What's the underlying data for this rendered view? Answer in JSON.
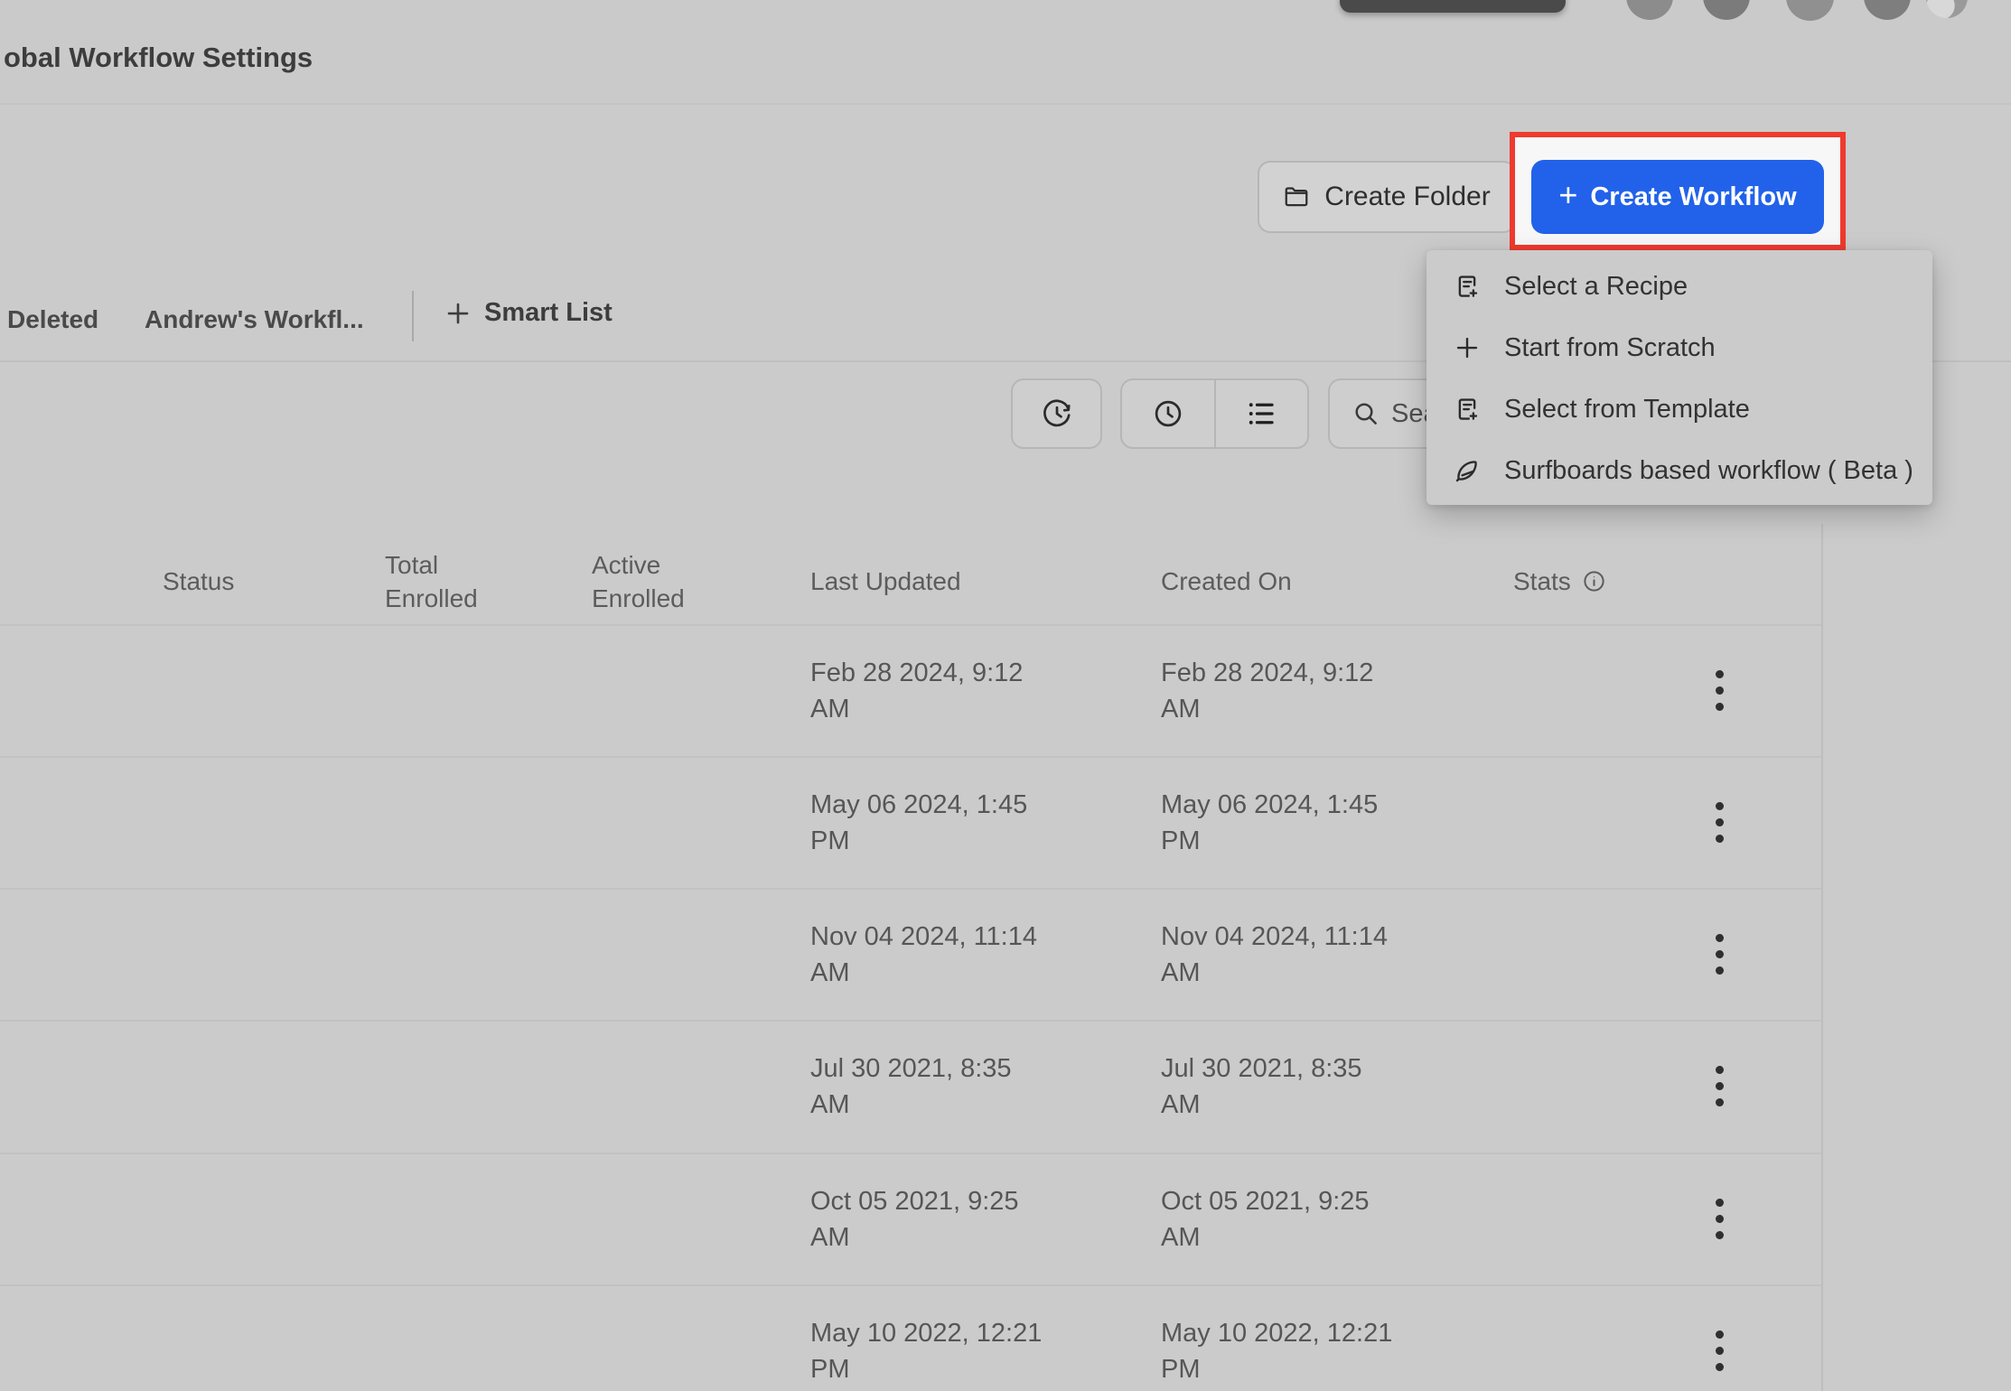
{
  "header": {
    "title": "obal Workflow Settings",
    "avatars": [
      "avatar-1",
      "avatar-2",
      "avatar-3",
      "avatar-4",
      "avatar-photo"
    ]
  },
  "toolbar": {
    "create_folder": "Create Folder",
    "create_workflow": "Create Workflow",
    "create_workflow_plus": "+"
  },
  "create_menu": {
    "items": [
      {
        "label": "Select a Recipe",
        "icon": "doc-plus-icon"
      },
      {
        "label": "Start from Scratch",
        "icon": "plus-icon"
      },
      {
        "label": "Select from Template",
        "icon": "doc-plus-icon"
      },
      {
        "label": "Surfboards based workflow ( Beta )",
        "icon": "surfboard-icon"
      }
    ]
  },
  "tabs": {
    "deleted": "Deleted",
    "andrews": "Andrew's Workfl...",
    "smart_list": "Smart List"
  },
  "search": {
    "visible_text": "Sea"
  },
  "table": {
    "columns": {
      "status": "Status",
      "total_enrolled": "Total Enrolled",
      "active_enrolled": "Active Enrolled",
      "last_updated": "Last Updated",
      "created_on": "Created On",
      "stats": "Stats"
    },
    "rows": [
      {
        "last_updated": [
          "Feb 28 2024, 9:12",
          "AM"
        ],
        "created_on": [
          "Feb 28 2024, 9:12",
          "AM"
        ]
      },
      {
        "last_updated": [
          "May 06 2024, 1:45",
          "PM"
        ],
        "created_on": [
          "May 06 2024, 1:45",
          "PM"
        ]
      },
      {
        "last_updated": [
          "Nov 04 2024, 11:14",
          "AM"
        ],
        "created_on": [
          "Nov 04 2024, 11:14",
          "AM"
        ]
      },
      {
        "last_updated": [
          "Jul 30 2021, 8:35",
          "AM"
        ],
        "created_on": [
          "Jul 30 2021, 8:35",
          "AM"
        ]
      },
      {
        "last_updated": [
          "Oct 05 2021, 9:25",
          "AM"
        ],
        "created_on": [
          "Oct 05 2021, 9:25",
          "AM"
        ]
      },
      {
        "last_updated": [
          "May 10 2022, 12:21",
          "PM"
        ],
        "created_on": [
          "May 10 2022, 12:21",
          "PM"
        ]
      }
    ]
  },
  "colors": {
    "accent_blue": "#2262ea",
    "highlight_red": "#ee3a2f",
    "page_bg": "#cbcbcb"
  }
}
